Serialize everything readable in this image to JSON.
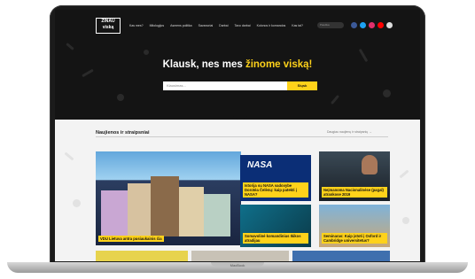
{
  "site": {
    "logo_line1": "ŽINAU",
    "logo_line2": "viską"
  },
  "nav": {
    "items": [
      "Kas mes?",
      "Mitologijos",
      "Asmens politika",
      "Savanoriai",
      "Darbai",
      "Tavo darbai",
      "Kolonos ir komandos",
      "Kas tai?"
    ],
    "search_placeholder": "Paieška"
  },
  "social": {
    "colors": [
      "#3b5998",
      "#1da1f2",
      "#e1306c",
      "#ff0000",
      "#dddddd"
    ],
    "icons": [
      "facebook-icon",
      "twitter-icon",
      "instagram-icon",
      "youtube-icon",
      "email-icon"
    ]
  },
  "hero": {
    "headline_prefix": "Klausk, nes mes ",
    "headline_highlight": "žinome viską!",
    "search_placeholder": "Klausimas...",
    "search_button": "Siųsk"
  },
  "news": {
    "section_title": "Naujienos ir straipsniai",
    "more_link": "Daugiau naujienų ir straipsnių →",
    "cards": [
      {
        "caption": "VDU Lietuva antra pusiaukainis čia"
      },
      {
        "caption": "Istorija su NASA vadovybe Dorotėa Čelėnų: kaip patekti į NASA?"
      },
      {
        "caption": "Neįmanoma Nacionalinėse (pagal) atrankose 2019"
      },
      {
        "caption": "Somavolinė komandinius Ikikos atradijau"
      },
      {
        "caption": "Seminaras: Kaip įstoti į Oxford ir Cambridge universitetus?"
      }
    ]
  },
  "device": {
    "label": "MacBook"
  }
}
